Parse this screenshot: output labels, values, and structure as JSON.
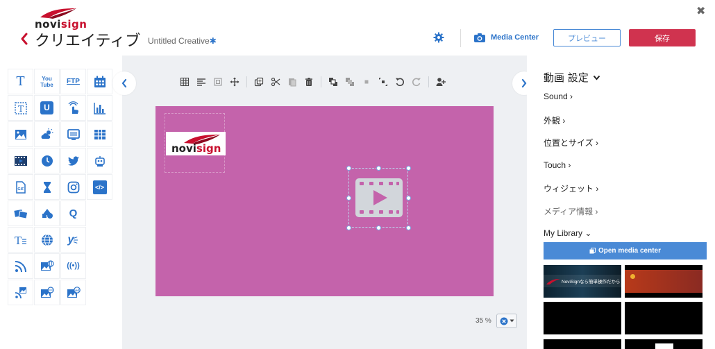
{
  "header": {
    "logo_prefix": "novi",
    "logo_accent": "sign",
    "title": "クリエイティブ",
    "creative_name": "Untitled Creative",
    "unsaved_marker": "✱",
    "media_center": "Media Center",
    "preview_label": "プレビュー",
    "save_label": "保存",
    "close_glyph": "✖"
  },
  "palette": {
    "items": [
      {
        "name": "text",
        "label": "T"
      },
      {
        "name": "youtube",
        "label": "You Tube"
      },
      {
        "name": "ftp",
        "label": "FTP"
      },
      {
        "name": "calendar",
        "label": ""
      },
      {
        "name": "ticker",
        "label": ""
      },
      {
        "name": "untappd",
        "label": "U"
      },
      {
        "name": "touch",
        "label": ""
      },
      {
        "name": "bar-chart",
        "label": ""
      },
      {
        "name": "image",
        "label": ""
      },
      {
        "name": "weather",
        "label": ""
      },
      {
        "name": "screen",
        "label": ""
      },
      {
        "name": "table",
        "label": ""
      },
      {
        "name": "video",
        "label": ""
      },
      {
        "name": "clock",
        "label": ""
      },
      {
        "name": "twitter",
        "label": ""
      },
      {
        "name": "robot",
        "label": ""
      },
      {
        "name": "gif",
        "label": "GIF"
      },
      {
        "name": "hourglass",
        "label": ""
      },
      {
        "name": "instagram",
        "label": ""
      },
      {
        "name": "html",
        "label": "</>"
      },
      {
        "name": "gallery",
        "label": ""
      },
      {
        "name": "shapes",
        "label": ""
      },
      {
        "name": "queue",
        "label": "Q"
      },
      {
        "name": "rich-text",
        "label": "T"
      },
      {
        "name": "web",
        "label": ""
      },
      {
        "name": "yelp",
        "label": "y"
      },
      {
        "name": "rss",
        "label": ""
      },
      {
        "name": "web-image",
        "label": ""
      },
      {
        "name": "broadcast",
        "label": "((•))"
      },
      {
        "name": "rss-image",
        "label": ""
      },
      {
        "name": "web-gallery",
        "label": ""
      },
      {
        "name": "ad-image",
        "label": "Ad"
      }
    ]
  },
  "canvas": {
    "background": "#c463ab",
    "logo_prefix": "novi",
    "logo_accent": "sign",
    "zoom_label": "35 %"
  },
  "panel": {
    "title": "動画 設定",
    "sections": [
      {
        "label": "Sound ›",
        "muted": false
      },
      {
        "label": "外観 ›",
        "muted": false
      },
      {
        "label": "位置とサイズ ›",
        "muted": false
      },
      {
        "label": "Touch ›",
        "muted": false
      },
      {
        "label": "ウィジェット ›",
        "muted": false
      },
      {
        "label": "メディア情報 ›",
        "muted": true
      },
      {
        "label": "My Library ⌄",
        "muted": false
      }
    ],
    "open_media_label": "Open media center",
    "thumb_caption": "NoviSignなら簡単操作だから"
  },
  "colors": {
    "accent": "#2b73c9",
    "save": "#d0334f",
    "canvas": "#c463ab",
    "open_media": "#4a8ad6"
  }
}
